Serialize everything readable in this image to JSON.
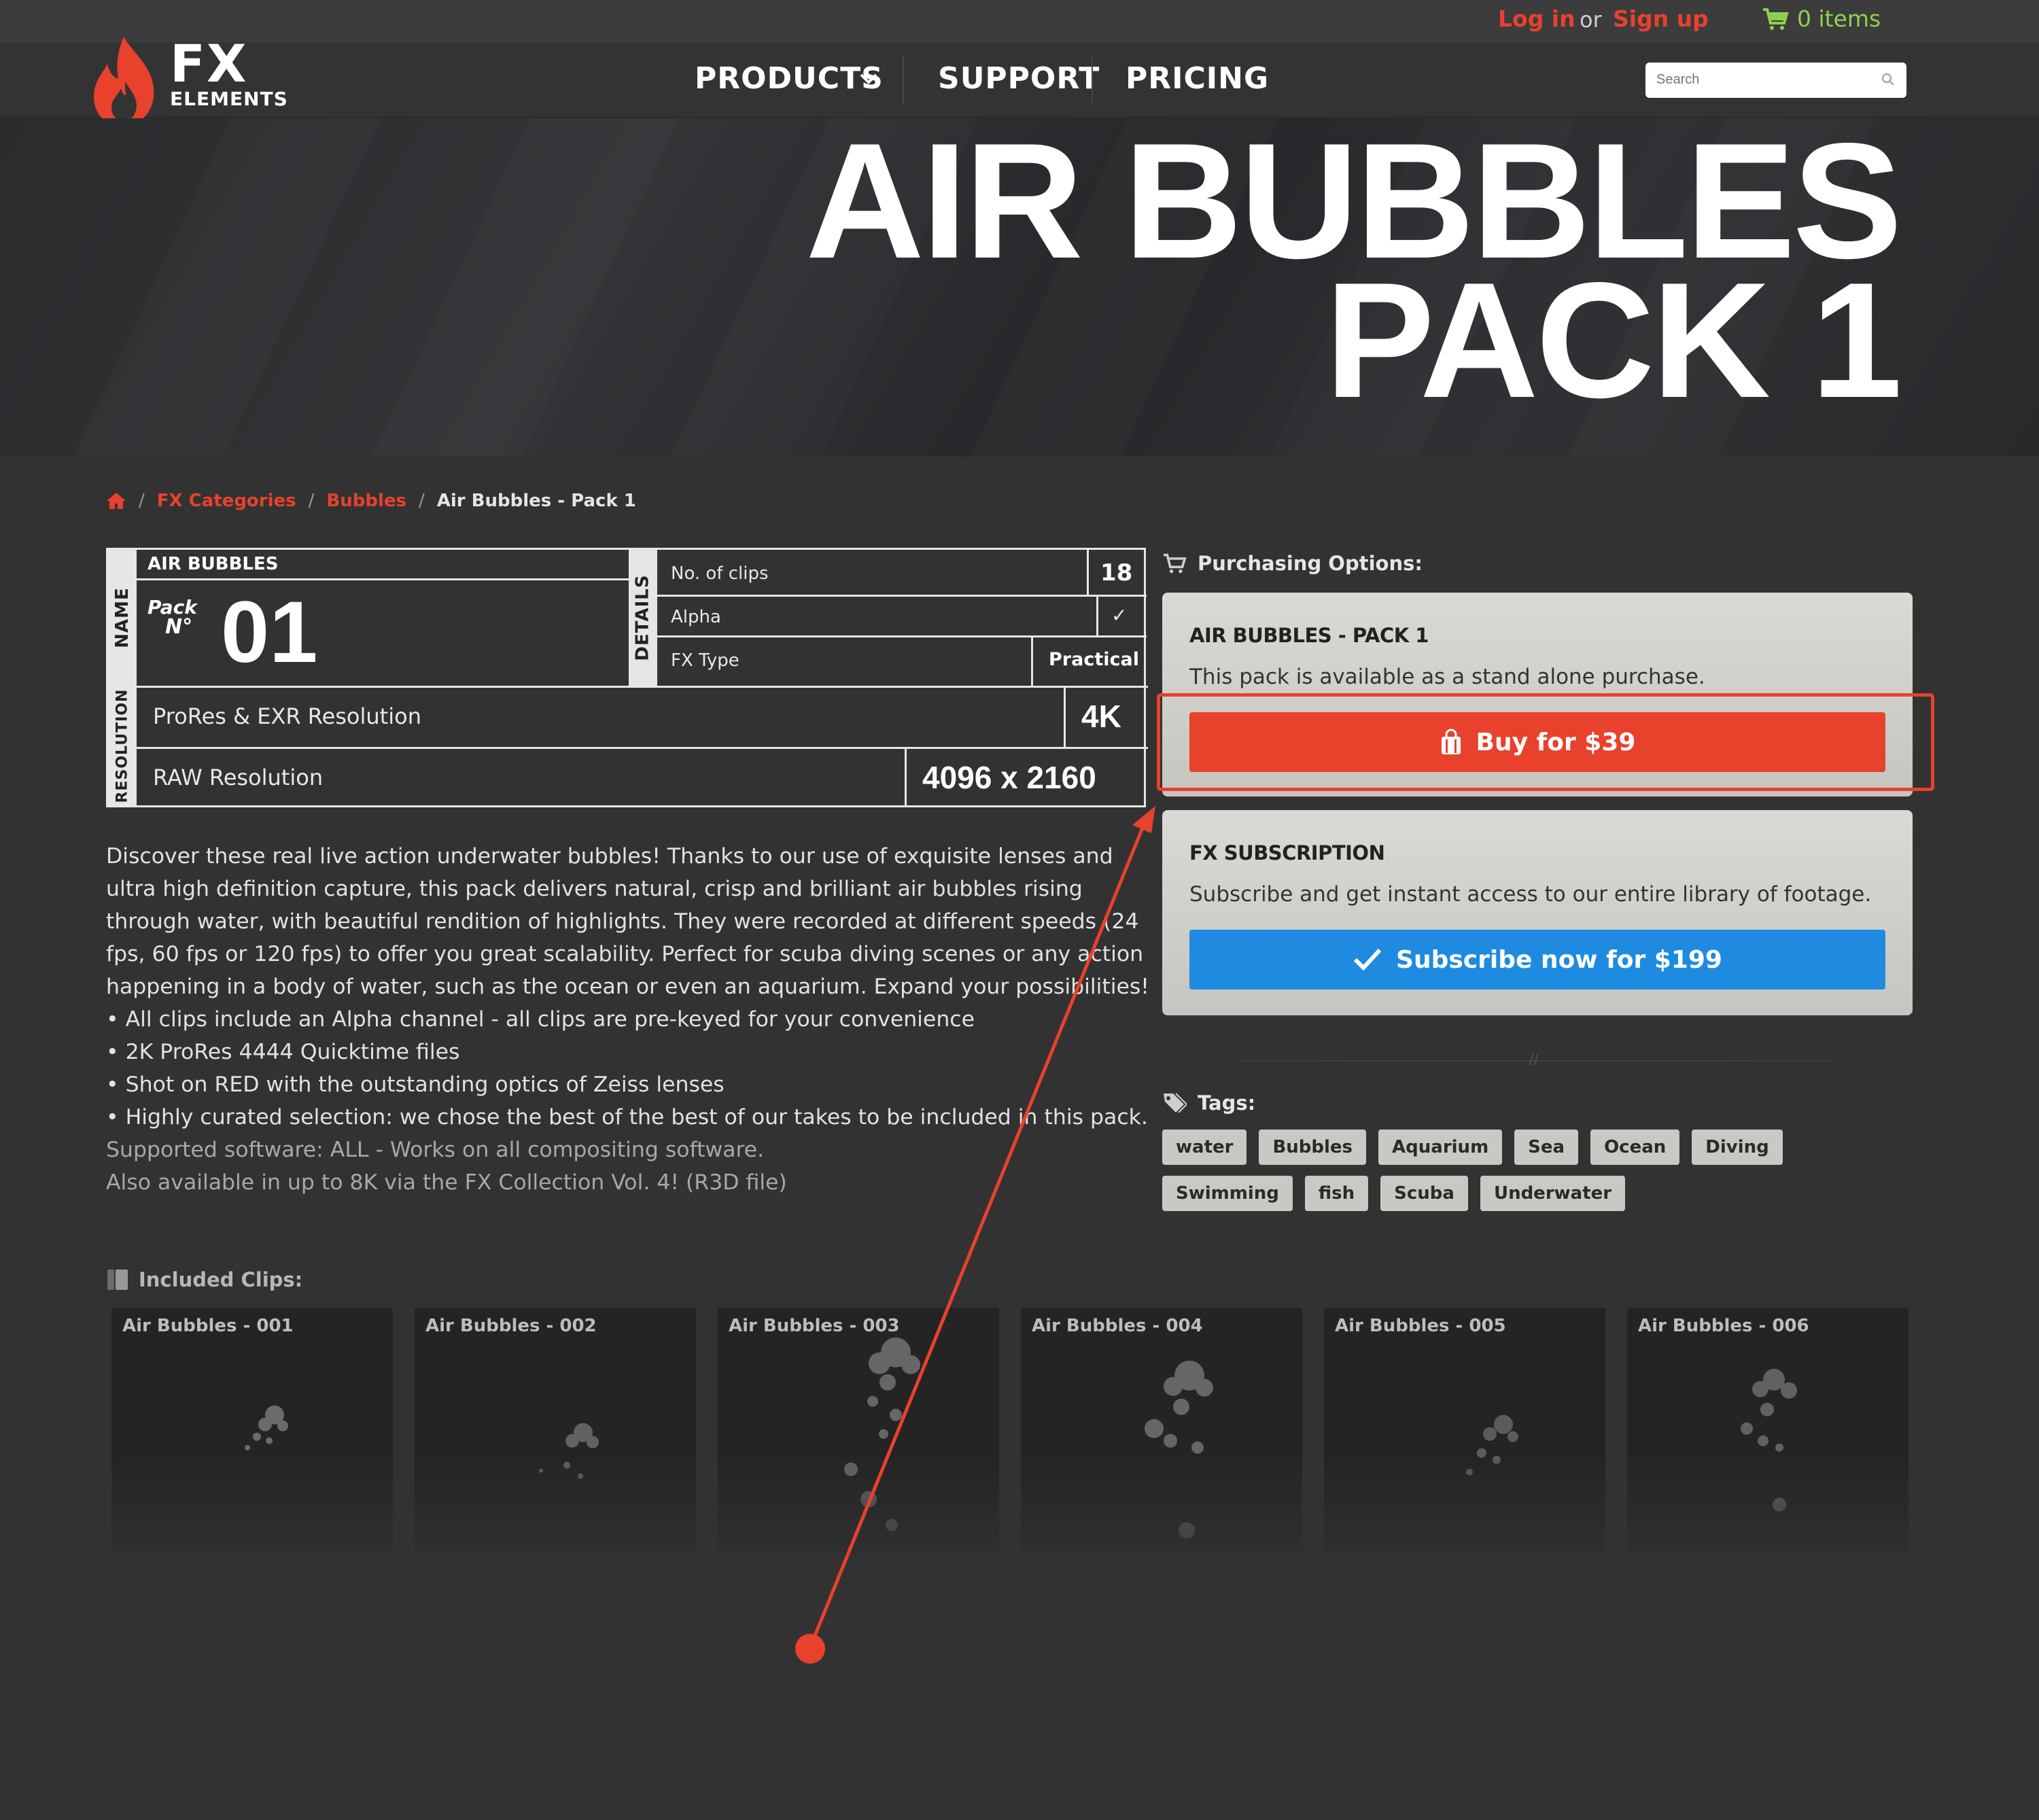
{
  "topbar": {
    "login": "Log in",
    "or": "or",
    "signup": "Sign up",
    "cart": "0 items"
  },
  "brand": {
    "line1": "FX",
    "line2": "ELEMENTS"
  },
  "nav": {
    "products": "PRODUCTS",
    "support": "SUPPORT",
    "pricing": "PRICING"
  },
  "search": {
    "placeholder": "Search"
  },
  "hero": {
    "title_line1": "AIR BUBBLES",
    "title_line2": "PACK 1"
  },
  "breadcrumb": {
    "sep": "/",
    "item1": "FX Categories",
    "item2": "Bubbles",
    "current": "Air Bubbles - Pack 1"
  },
  "spec": {
    "name_label": "NAME",
    "details_label": "DETAILS",
    "resolution_label": "RESOLUTION",
    "pack_name": "AIR BUBBLES",
    "pack_word": "Pack",
    "pack_no": "N°",
    "pack_number": "01",
    "clips_label": "No. of clips",
    "clips_value": "18",
    "alpha_label": "Alpha",
    "alpha_value": "✓",
    "fxtype_label": "FX Type",
    "fxtype_value": "Practical",
    "prores_label": "ProRes & EXR Resolution",
    "prores_value": "4K",
    "raw_label": "RAW Resolution",
    "raw_value": "4096 x 2160"
  },
  "description": {
    "paragraph": "Discover these real live action underwater bubbles! Thanks to our use of exquisite lenses and ultra high definition capture, this pack delivers natural, crisp and brilliant air bubbles rising through water, with beautiful rendition of highlights. They were recorded at different speeds (24 fps, 60 fps or 120 fps) to offer you great scalability. Perfect for scuba diving scenes or any action happening in a body of water, such as the ocean or even an aquarium. Expand your possibilities!",
    "bullets": [
      "• All clips include an Alpha channel - all clips are pre-keyed for your convenience",
      "• 2K ProRes 4444 Quicktime files",
      "• Shot on RED with the outstanding optics of Zeiss lenses",
      "• Highly curated selection: we chose the best of the best of our takes to be included in this pack."
    ],
    "supported": "Supported software: ALL - Works on all compositing software.",
    "also": "Also available in up to 8K via the FX Collection Vol. 4! (R3D file)"
  },
  "purchasing": {
    "title": "Purchasing Options:",
    "pack_card": {
      "heading": "AIR BUBBLES - PACK 1",
      "text": "This pack is available as a stand alone purchase.",
      "button": "Buy for $39"
    },
    "sub_card": {
      "heading": "FX SUBSCRIPTION",
      "text": "Subscribe and get instant access to our entire library of footage.",
      "button": "Subscribe now for $199"
    }
  },
  "divider_mark": "//",
  "tags": {
    "title": "Tags:",
    "items": [
      "water",
      "Bubbles",
      "Aquarium",
      "Sea",
      "Ocean",
      "Diving",
      "Swimming",
      "fish",
      "Scuba",
      "Underwater"
    ]
  },
  "clips": {
    "title": "Included Clips:",
    "items": [
      "Air Bubbles - 001",
      "Air Bubbles - 002",
      "Air Bubbles - 003",
      "Air Bubbles - 004",
      "Air Bubbles - 005",
      "Air Bubbles - 006"
    ]
  },
  "colors": {
    "accent_red": "#e8412c",
    "accent_blue": "#1e8be0",
    "cart_green": "#8fd14f",
    "background": "#323232"
  },
  "icons": {
    "home": "home-icon",
    "cart": "cart-icon",
    "search": "search-icon",
    "tag": "tag-icon",
    "bag": "shopping-bag-icon",
    "check": "check-icon",
    "clip": "film-icon"
  }
}
